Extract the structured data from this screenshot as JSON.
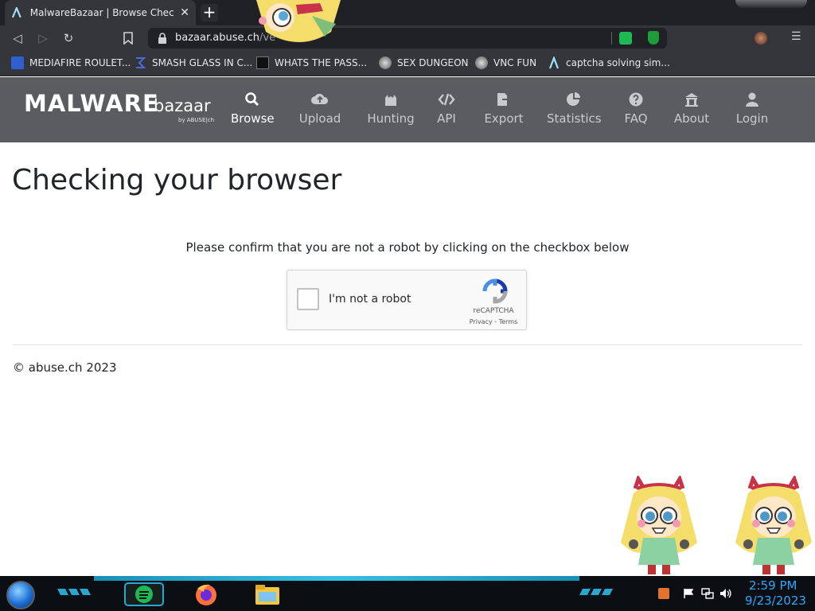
{
  "browser": {
    "tab_title": "MalwareBazaar | Browse Checking",
    "tab_close": "✕",
    "new_tab": "+",
    "url_host": "bazaar.abuse.ch",
    "url_path": "/ve",
    "nav": {
      "back": "◁",
      "forward": "▷",
      "reload": "↻",
      "bookmark": "🔖",
      "menu": "☰"
    }
  },
  "bookmarks": [
    {
      "label": "MEDIAFIRE ROULET...",
      "icon": "mediafire-icon"
    },
    {
      "label": "SMASH GLASS IN C...",
      "icon": "sigma-icon"
    },
    {
      "label": "WHATS THE PASS...",
      "icon": "tv-icon"
    },
    {
      "label": "SEX DUNGEON",
      "icon": "alien-icon"
    },
    {
      "label": "VNC FUN",
      "icon": "alien-icon"
    },
    {
      "label": "captcha solving sim...",
      "icon": "arrow-a-icon"
    }
  ],
  "site": {
    "logo_main": "MALWARE",
    "logo_sub": "bazaar",
    "logo_by": "by ABUSE|ch",
    "nav": [
      {
        "label": "Browse",
        "icon": "search-icon",
        "active": true
      },
      {
        "label": "Upload",
        "icon": "upload-icon"
      },
      {
        "label": "Hunting",
        "icon": "hunting-icon"
      },
      {
        "label": "API",
        "icon": "code-icon"
      },
      {
        "label": "Export",
        "icon": "export-icon"
      },
      {
        "label": "Statistics",
        "icon": "pie-chart-icon"
      },
      {
        "label": "FAQ",
        "icon": "question-icon"
      },
      {
        "label": "About",
        "icon": "building-icon"
      },
      {
        "label": "Login",
        "icon": "user-icon"
      }
    ]
  },
  "content": {
    "heading": "Checking your browser",
    "prompt": "Please confirm that you are not a robot by clicking on the checkbox below",
    "captcha": {
      "label": "I'm not a robot",
      "brand": "reCAPTCHA",
      "links": "Privacy - Terms"
    },
    "footer": "© abuse.ch 2023"
  },
  "taskbar": {
    "time": "2:59 PM",
    "date": "9/23/2023",
    "colors": {
      "clock": "#29a8ff",
      "accent": "#37c0e6"
    }
  }
}
